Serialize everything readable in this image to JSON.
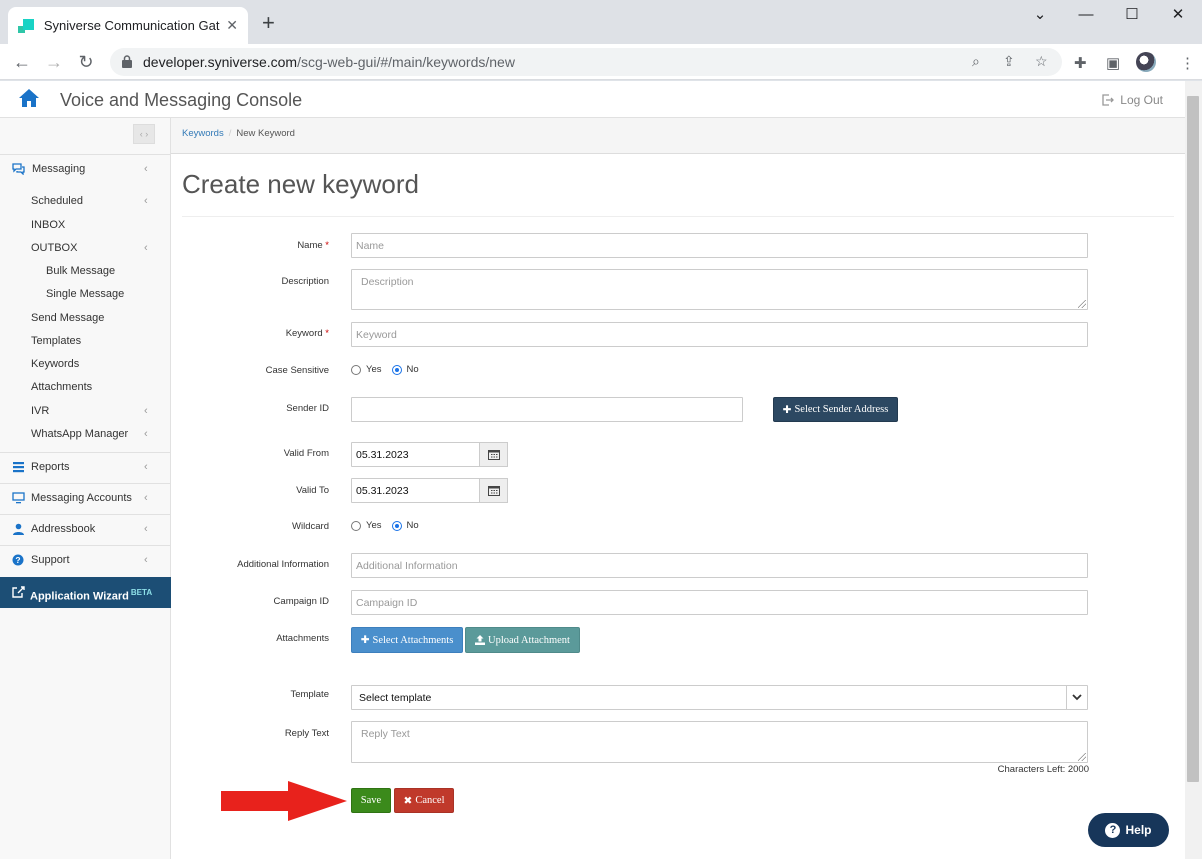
{
  "browser": {
    "tab_title": "Syniverse Communication Gatew",
    "tab_close": "✕",
    "new_tab": "+",
    "url_host": "developer.syniverse.com",
    "url_path": "/scg-web-gui/#/main/keywords/new",
    "window_controls": {
      "minimize": "⌄",
      "min": "—",
      "max": "☐",
      "close": "✕"
    }
  },
  "header": {
    "title": "Voice and Messaging Console",
    "logout_label": "Log Out"
  },
  "sidebar": {
    "messaging": {
      "label": "Messaging",
      "icon": "chat-icon"
    },
    "scheduled": "Scheduled",
    "inbox": "INBOX",
    "outbox": "OUTBOX",
    "bulk_message": "Bulk Message",
    "single_message": "Single Message",
    "send_message": "Send Message",
    "templates": "Templates",
    "keywords": "Keywords",
    "attachments": "Attachments",
    "ivr": "IVR",
    "whatsapp": "WhatsApp Manager",
    "reports": {
      "label": "Reports",
      "icon": "list-icon"
    },
    "messaging_accounts": {
      "label": "Messaging Accounts",
      "icon": "monitor-icon"
    },
    "addressbook": {
      "label": "Addressbook",
      "icon": "person-icon"
    },
    "support": {
      "label": "Support",
      "icon": "question-icon"
    },
    "wizard": {
      "label": "Application Wizard",
      "badge": "BETA",
      "icon": "external-link-icon"
    },
    "chevron": "‹"
  },
  "breadcrumb": {
    "parent": "Keywords",
    "separator": "/",
    "current": "New Keyword"
  },
  "page_title": "Create new keyword",
  "form": {
    "name": {
      "label": "Name",
      "required": "*",
      "placeholder": "Name"
    },
    "description": {
      "label": "Description",
      "placeholder": "Description"
    },
    "keyword": {
      "label": "Keyword",
      "required": "*",
      "placeholder": "Keyword"
    },
    "case_sensitive": {
      "label": "Case Sensitive",
      "yes": "Yes",
      "no": "No",
      "selected": "No"
    },
    "sender_id": {
      "label": "Sender ID",
      "value": "",
      "button": "Select Sender Address"
    },
    "valid_from": {
      "label": "Valid From",
      "value": "05.31.2023"
    },
    "valid_to": {
      "label": "Valid To",
      "value": "05.31.2023"
    },
    "wildcard": {
      "label": "Wildcard",
      "yes": "Yes",
      "no": "No",
      "selected": "No"
    },
    "additional_info": {
      "label": "Additional Information",
      "placeholder": "Additional Information"
    },
    "campaign_id": {
      "label": "Campaign ID",
      "placeholder": "Campaign ID"
    },
    "attachments": {
      "label": "Attachments",
      "select_button": "Select Attachments",
      "upload_button": "Upload Attachment"
    },
    "template": {
      "label": "Template",
      "selected": "Select template"
    },
    "reply_text": {
      "label": "Reply Text",
      "placeholder": "Reply Text",
      "chars_left": "Characters Left: 2000"
    },
    "save_button": "Save",
    "cancel_button": "Cancel"
  },
  "help_button": "Help",
  "colors": {
    "accent": "#1c4e75",
    "save": "#3b8a1b",
    "cancel": "#c0392b",
    "link": "#337ab7",
    "annotation_arrow": "#e8221c"
  }
}
